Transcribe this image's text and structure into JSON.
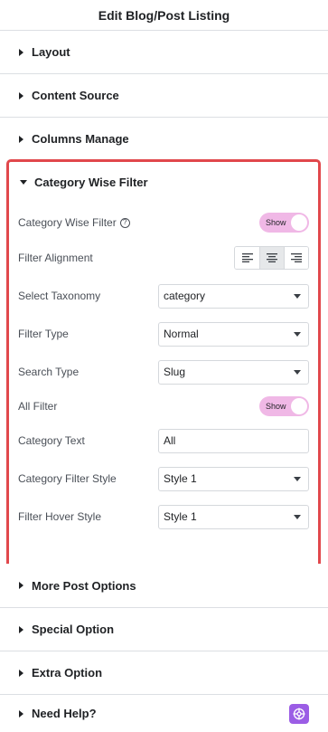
{
  "header": {
    "title": "Edit Blog/Post Listing"
  },
  "sections_top": [
    {
      "label": "Layout"
    },
    {
      "label": "Content Source"
    },
    {
      "label": "Columns Manage"
    }
  ],
  "active_section": {
    "label": "Category Wise Filter",
    "controls": {
      "category_wise_filter": {
        "label": "Category Wise Filter",
        "toggle": "Show",
        "help_icon": "question-circle-icon"
      },
      "filter_alignment": {
        "label": "Filter Alignment",
        "options": [
          "align-left-icon",
          "align-center-icon",
          "align-right-icon"
        ],
        "selected": "align-center-icon"
      },
      "select_taxonomy": {
        "label": "Select Taxonomy",
        "value": "category"
      },
      "filter_type": {
        "label": "Filter Type",
        "value": "Normal"
      },
      "search_type": {
        "label": "Search Type",
        "value": "Slug"
      },
      "all_filter": {
        "label": "All Filter",
        "toggle": "Show"
      },
      "category_text": {
        "label": "Category Text",
        "value": "All"
      },
      "category_filter_style": {
        "label": "Category Filter Style",
        "value": "Style 1"
      },
      "filter_hover_style": {
        "label": "Filter Hover Style",
        "value": "Style 1"
      }
    }
  },
  "sections_bottom": [
    {
      "label": "More Post Options"
    },
    {
      "label": "Special Option"
    },
    {
      "label": "Extra Option"
    },
    {
      "label": "Need Help?",
      "icon": "help-widget-icon"
    }
  ],
  "colors": {
    "active_border": "#e1484c",
    "toggle_on": "#f0b8e6",
    "help_badge": "#9b5de5"
  }
}
